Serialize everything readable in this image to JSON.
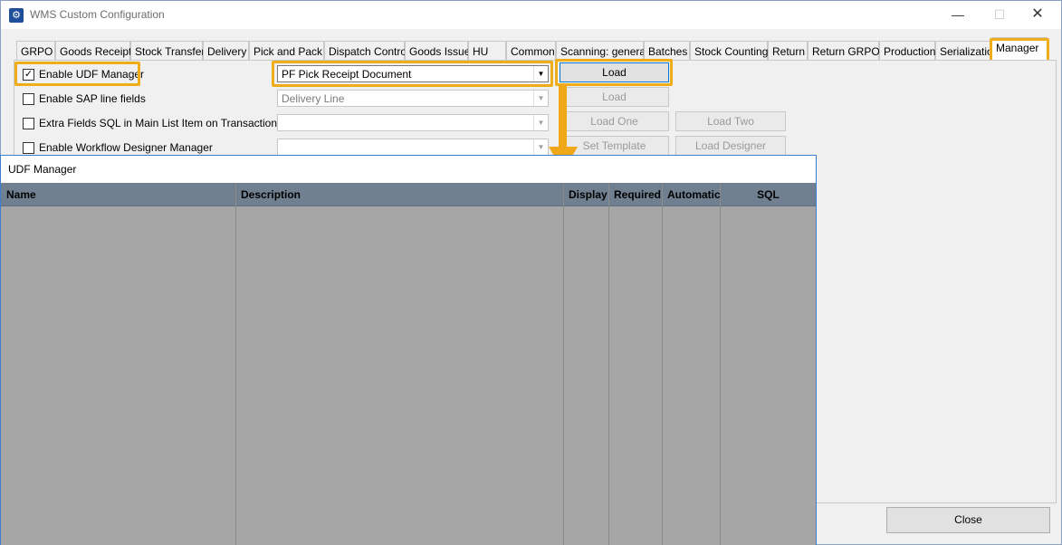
{
  "window": {
    "title": "WMS Custom Configuration",
    "min": "—",
    "max": "☐",
    "close": "✕"
  },
  "tabs": [
    "GRPO",
    "Goods Receipt",
    "Stock Transfer",
    "Delivery",
    "Pick and Pack",
    "Dispatch Control",
    "Goods Issue",
    "HU",
    "Common",
    "Scanning: general",
    "Batches",
    "Stock Counting",
    "Return",
    "Return GRPO",
    "Production",
    "Serialization",
    "Manager"
  ],
  "active_tab": "Manager",
  "options": [
    {
      "label": "Enable UDF Manager",
      "checked": true
    },
    {
      "label": "Enable SAP line fields",
      "checked": false
    },
    {
      "label": "Extra Fields SQL in Main List Item on Transaction",
      "checked": false
    },
    {
      "label": "Enable Workflow Designer Manager",
      "checked": false
    }
  ],
  "combos": [
    "PF Pick Receipt Document",
    "Delivery Line",
    "",
    ""
  ],
  "buttons": {
    "load_1": "Load",
    "load_2": "Load",
    "load_one": "Load One",
    "load_two": "Load Two",
    "set_template": "Set Template",
    "load_designer": "Load Designer",
    "close": "Close"
  },
  "udf_manager": {
    "title": "UDF Manager",
    "columns": [
      "Name",
      "Description",
      "Display",
      "Required",
      "Automatic",
      "SQL"
    ]
  },
  "colors": {
    "highlight": "#f0ad1a",
    "grid_header": "#708090",
    "grid_body": "#a6a6a6"
  }
}
